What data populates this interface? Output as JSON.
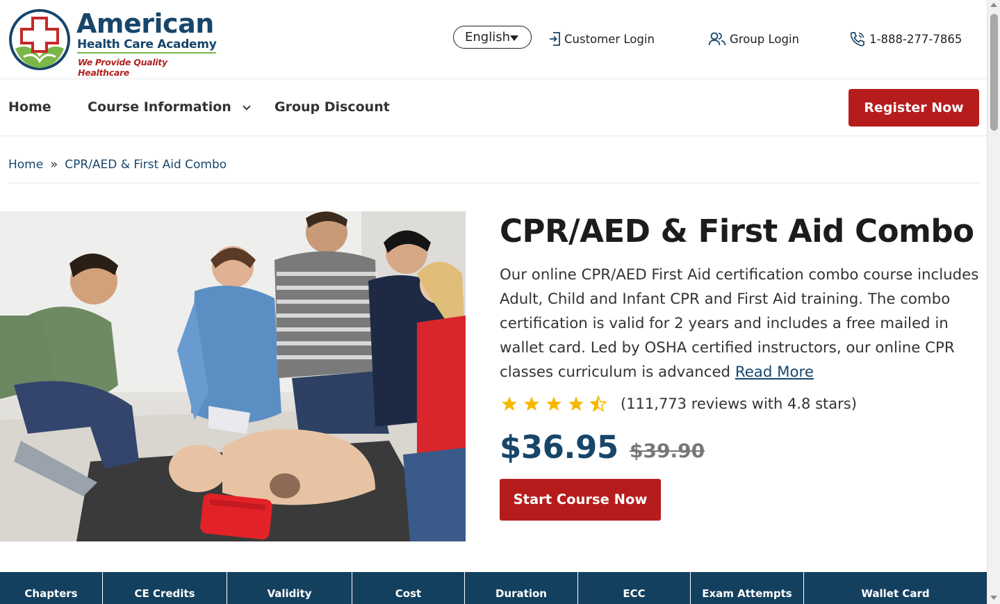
{
  "brand": {
    "name": "American",
    "subname": "Health Care Academy",
    "tagline": "We Provide Quality Healthcare"
  },
  "header": {
    "language": "English",
    "customer_login": "Customer Login",
    "group_login": "Group Login",
    "phone": "1-888-277-7865"
  },
  "nav": {
    "items": [
      {
        "label": "Home"
      },
      {
        "label": "Course Information"
      },
      {
        "label": "Group Discount"
      }
    ],
    "register_label": "Register Now"
  },
  "breadcrumb": {
    "home": "Home",
    "sep": "»",
    "current": "CPR/AED & First Aid Combo"
  },
  "product": {
    "title": "CPR/AED & First Aid Combo",
    "description": "Our online CPR/AED First Aid certification combo course includes Adult, Child and Infant CPR and First Aid training. The combo certification is valid for 2 years and includes a free mailed in wallet card. Led by OSHA certified instructors, our online CPR classes curriculum is advanced",
    "read_more": "Read More",
    "rating_stars": 4.5,
    "reviews_text": "(111,773 reviews with 4.8 stars)",
    "price": "$36.95",
    "old_price": "$39.90",
    "cta": "Start Course Now"
  },
  "info_table": {
    "headers": [
      "Chapters",
      "CE Credits",
      "Validity",
      "Cost",
      "Duration",
      "ECC",
      "Exam Attempts",
      "Wallet Card"
    ]
  },
  "colors": {
    "brand_navy": "#17466b",
    "brand_red": "#b71c1c",
    "table_header": "#14405f",
    "star": "#f5b800"
  }
}
